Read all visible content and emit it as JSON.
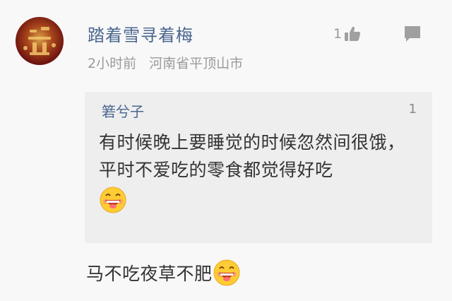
{
  "comment": {
    "author": "踏着雪寻着梅",
    "time": "2小时前",
    "location": "河南省平顶山市",
    "likes": "1",
    "reply_text": "马不吃夜草不肥",
    "reply_emoji": "grinning-face-emoji"
  },
  "quoted": {
    "author": "箬兮子",
    "floor": "1",
    "text": "有时候晚上要睡觉的时候忽然间很饿，平时不爱吃的零食都觉得好吃",
    "emoji": "grinning-face-emoji"
  },
  "icons": {
    "like": "thumbs-up-icon",
    "comment": "comment-icon"
  },
  "colors": {
    "username": "#4a6690",
    "meta": "#9a9a9a",
    "quote_bg": "#eeeeee",
    "background": "#f8f8f8"
  }
}
